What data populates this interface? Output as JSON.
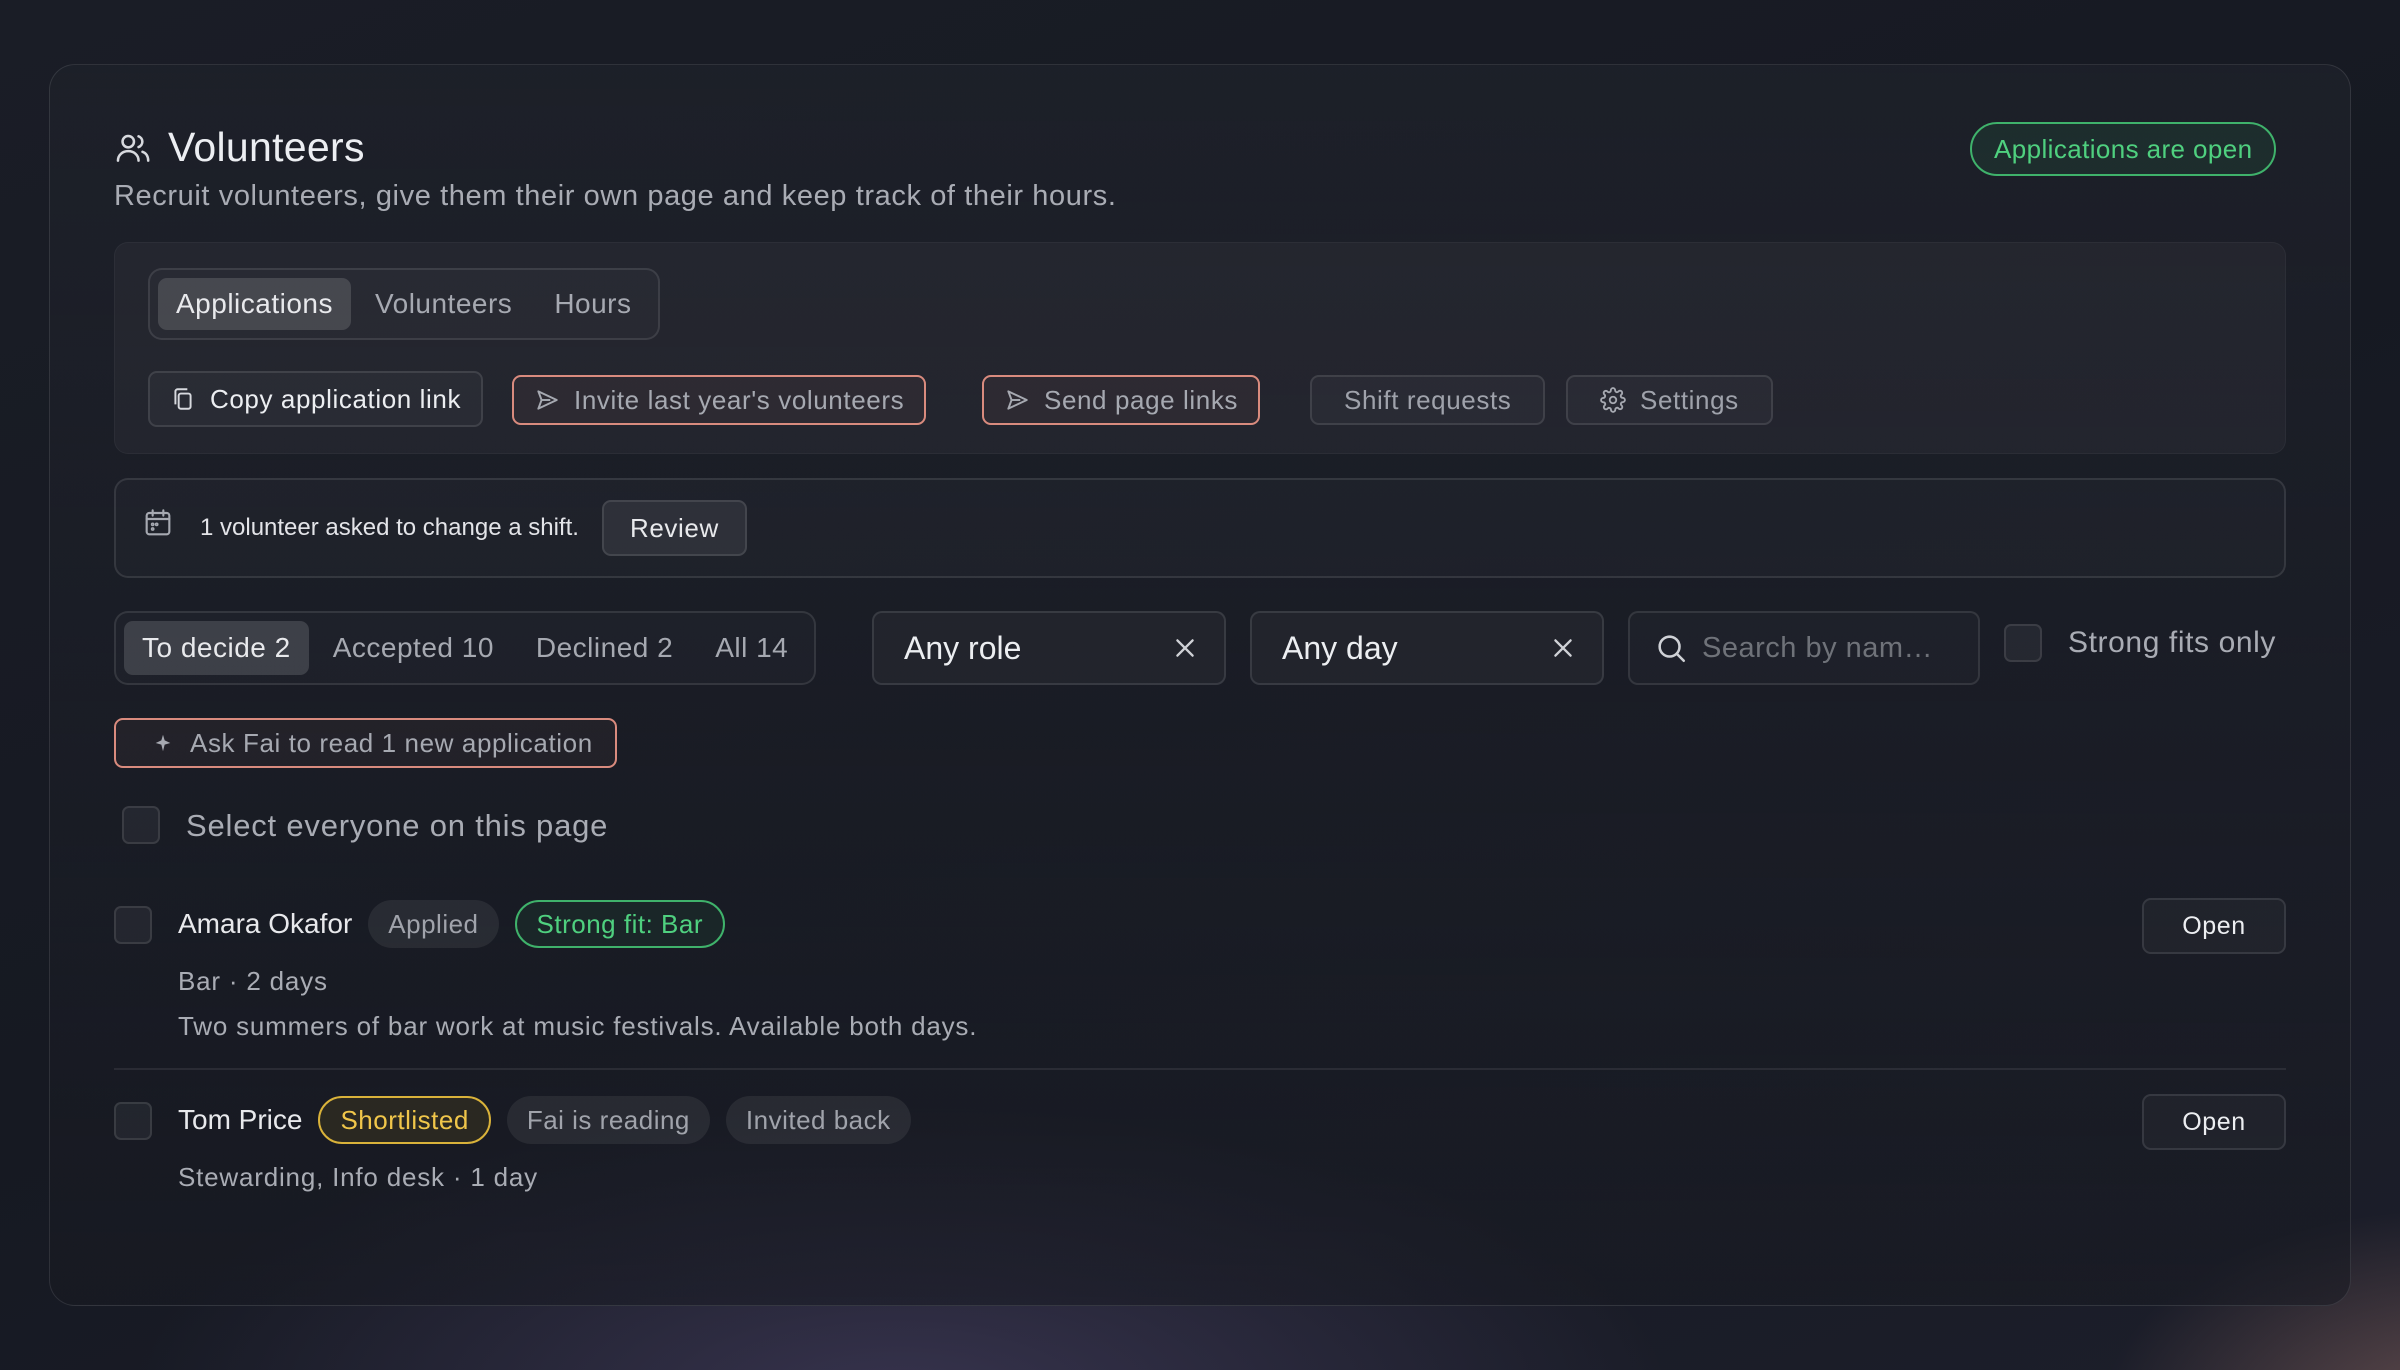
{
  "header": {
    "title": "Volunteers",
    "subtitle": "Recruit volunteers, give them their own page and keep track of their hours.",
    "status_badge": "Applications are open"
  },
  "tabs": [
    {
      "label": "Applications",
      "active": true
    },
    {
      "label": "Volunteers",
      "active": false
    },
    {
      "label": "Hours",
      "active": false
    }
  ],
  "actions": {
    "copy_link": "Copy application link",
    "invite_last_year": "Invite last year's volunteers",
    "send_page_links": "Send page links",
    "shift_requests": "Shift requests",
    "settings": "Settings"
  },
  "notice": {
    "text": "1 volunteer asked to change a shift.",
    "button": "Review"
  },
  "filters": {
    "status_tabs": [
      {
        "label": "To decide 2",
        "active": true
      },
      {
        "label": "Accepted 10",
        "active": false
      },
      {
        "label": "Declined 2",
        "active": false
      },
      {
        "label": "All 14",
        "active": false
      }
    ],
    "role_select": "Any role",
    "day_select": "Any day",
    "search_placeholder": "Search by nam…",
    "strong_fits_label": "Strong fits only"
  },
  "ask_fai": "Ask Fai to read 1 new application",
  "select_all_label": "Select everyone on this page",
  "applicants": [
    {
      "name": "Amara Okafor",
      "status": "Applied",
      "fit": "Strong fit: Bar",
      "meta": "Bar · 2 days",
      "note": "Two summers of bar work at music festivals. Available both days.",
      "open": "Open"
    },
    {
      "name": "Tom Price",
      "status": "Shortlisted",
      "tag1": "Fai is reading",
      "tag2": "Invited back",
      "meta": "Stewarding, Info desk · 1 day",
      "open": "Open"
    }
  ],
  "colors": {
    "accent_green": "#4fd07f",
    "accent_coral": "#d98b7e",
    "accent_yellow": "#f0c64a"
  },
  "icons": [
    "users-icon",
    "copy-icon",
    "send-icon",
    "gear-icon",
    "calendar-icon",
    "close-icon",
    "search-icon",
    "sparkle-icon"
  ]
}
